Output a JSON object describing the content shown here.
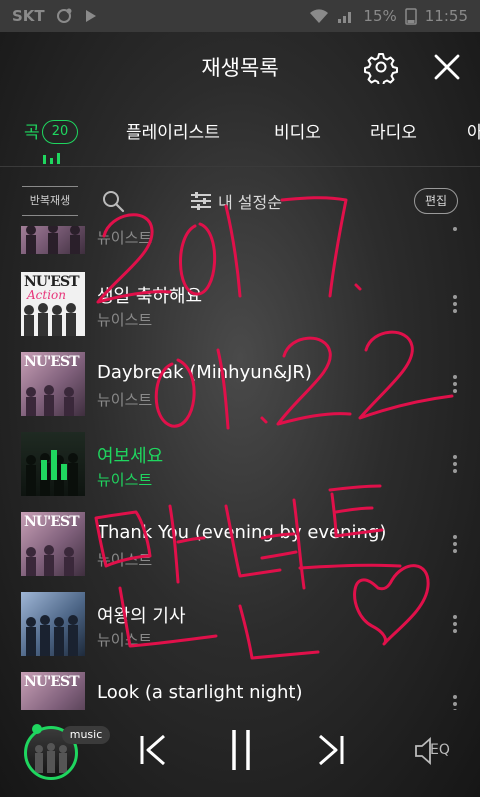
{
  "status": {
    "carrier": "SKT",
    "battery_pct": "15%",
    "time": "11:55"
  },
  "header": {
    "title": "재생목록"
  },
  "tabs": [
    {
      "label": "곡",
      "count": "20"
    },
    {
      "label": "플레이리스트"
    },
    {
      "label": "비디오"
    },
    {
      "label": "라디오"
    },
    {
      "label": "아"
    }
  ],
  "toolbar": {
    "repeat_label": "반복재생",
    "sort_label": "내 설정순",
    "edit_label": "편집"
  },
  "songs": [
    {
      "title": "",
      "artist": "뉴이스트"
    },
    {
      "title": "생일 축하해요",
      "artist": "뉴이스트"
    },
    {
      "title": "Daybreak (Minhyun&JR)",
      "artist": "뉴이스트"
    },
    {
      "title": "여보세요",
      "artist": "뉴이스트"
    },
    {
      "title": "Thank You (evening by evening)",
      "artist": "뉴이스트"
    },
    {
      "title": "여왕의 기사",
      "artist": "뉴이스트"
    },
    {
      "title": "Look (a starlight night)",
      "artist": ""
    }
  ],
  "album_art_text": {
    "nuest": "NU'EST",
    "action": "Action",
    "nuest_sub": "NU'EST"
  },
  "player": {
    "app_label": "music",
    "eq_label": "EQ"
  },
  "accent_color": "#1fd65f",
  "handwriting_color": "#e0104a"
}
